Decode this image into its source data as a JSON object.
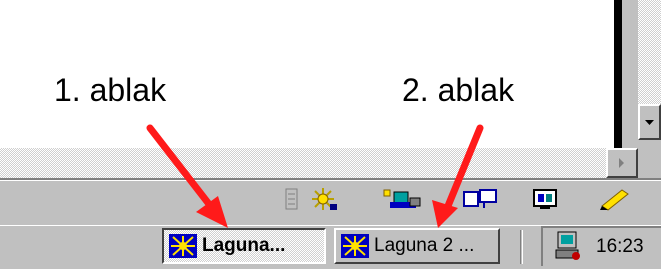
{
  "annotations": {
    "first": "1. ablak",
    "second": "2. ablak"
  },
  "taskbar": {
    "buttons": [
      {
        "label": "Laguna...",
        "icon": "laguna-star-icon",
        "active": true
      },
      {
        "label": "Laguna 2 ...",
        "icon": "laguna-star-icon",
        "active": false
      }
    ],
    "clock": "16:23"
  },
  "tray_icons": [
    "grip-icon",
    "star-icon",
    "network-icon",
    "messenger-icon",
    "display-icon",
    "pen-icon"
  ],
  "colors": {
    "arrow": "#ff1a1a",
    "face": "#c0c0c0",
    "icon_blue": "#0000c0",
    "icon_yellow": "#ffe000"
  }
}
